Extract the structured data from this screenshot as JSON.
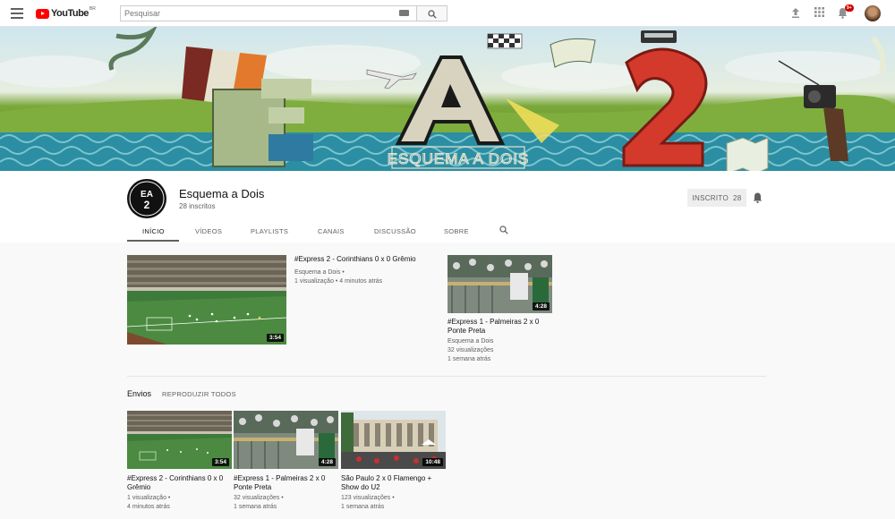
{
  "topbar": {
    "logo_text": "YouTube",
    "logo_region": "BR",
    "search_placeholder": "Pesquisar",
    "notification_count": "9+"
  },
  "channel": {
    "name": "Esquema a Dois",
    "subscribers": "28 inscritos",
    "avatar_text": "EA 2",
    "subscribe_label": "INSCRITO",
    "subscribe_count": "28",
    "banner_text": "ESQUEMA A DOIS"
  },
  "tabs": [
    {
      "label": "INÍCIO",
      "active": true
    },
    {
      "label": "VÍDEOS",
      "active": false
    },
    {
      "label": "PLAYLISTS",
      "active": false
    },
    {
      "label": "CANAIS",
      "active": false
    },
    {
      "label": "DISCUSSÃO",
      "active": false
    },
    {
      "label": "SOBRE",
      "active": false
    }
  ],
  "featured": {
    "title": "#Express 2 - Corinthians 0 x 0 Grêmio",
    "channel": "Esquema a Dois •",
    "meta": "1 visualização • 4 minutos atrás",
    "duration": "3:54"
  },
  "featured_side": {
    "title": "#Express 1 - Palmeiras 2 x 0 Ponte Preta",
    "channel": "Esquema a Dois",
    "views": "32 visualizações",
    "age": "1 semana atrás",
    "duration": "4:28"
  },
  "uploads": {
    "section_title": "Envios",
    "play_all": "REPRODUZIR TODOS",
    "items": [
      {
        "title": "#Express 2 - Corinthians 0 x 0 Grêmio",
        "views": "1 visualização •",
        "age": "4 minutos atrás",
        "duration": "3:54"
      },
      {
        "title": "#Express 1 - Palmeiras 2 x 0 Ponte Preta",
        "views": "32 visualizações •",
        "age": "1 semana atrás",
        "duration": "4:28"
      },
      {
        "title": "São Paulo 2 x 0 Flamengo + Show do U2",
        "views": "123 visualizações •",
        "age": "1 semana atrás",
        "duration": "10:48"
      }
    ]
  },
  "colors": {
    "brand_red": "#ff0000",
    "text_primary": "#111111",
    "text_secondary": "#606060"
  }
}
